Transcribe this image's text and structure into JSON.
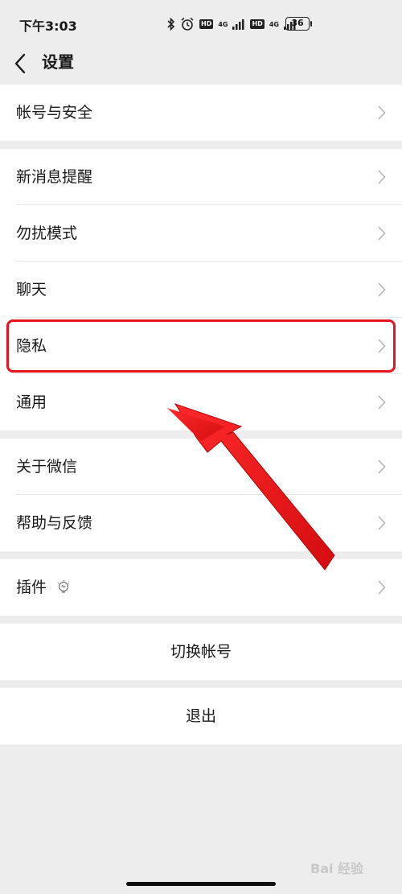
{
  "status_bar": {
    "time": "下午3:03",
    "hd1": "HD",
    "net1": "4G",
    "hd2": "HD",
    "net2": "4G",
    "battery": "36"
  },
  "nav": {
    "title": "设置",
    "back_icon": "chevron-left-icon"
  },
  "groups": [
    {
      "items": [
        {
          "label": "帐号与安全"
        }
      ]
    },
    {
      "items": [
        {
          "label": "新消息提醒"
        },
        {
          "label": "勿扰模式"
        },
        {
          "label": "聊天"
        },
        {
          "label": "隐私"
        },
        {
          "label": "通用"
        }
      ]
    },
    {
      "items": [
        {
          "label": "关于微信"
        },
        {
          "label": "帮助与反馈"
        }
      ]
    },
    {
      "items": [
        {
          "label": "插件",
          "icon": "lightbulb-icon"
        }
      ]
    }
  ],
  "actions": {
    "switch_account": "切换帐号",
    "logout": "退出"
  },
  "annotation": {
    "highlight_color": "#e8141d",
    "arrow_color": "#e8141d"
  },
  "watermark": "Bai 经验"
}
